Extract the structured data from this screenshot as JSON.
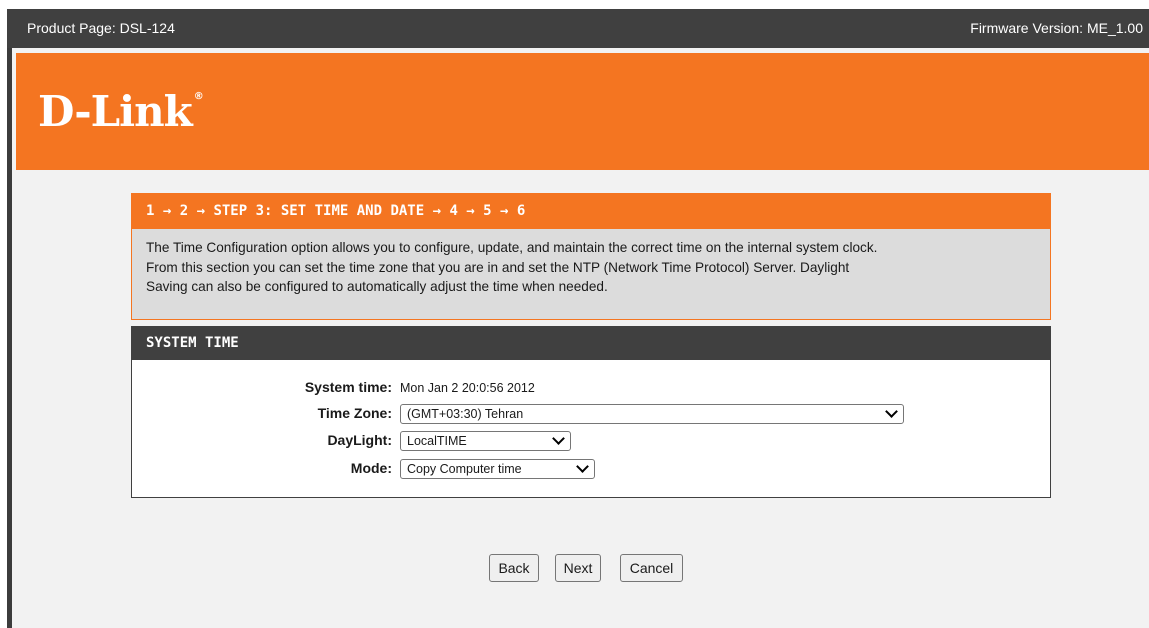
{
  "topbar": {
    "product": "Product Page: DSL-124",
    "firmware": "Firmware Version: ME_1.00"
  },
  "logo": {
    "text": "D-Link",
    "mark": "®"
  },
  "wizard": {
    "steps_prefix": "1 → 2 → ",
    "current_step": "STEP 3: SET TIME AND DATE",
    "steps_suffix": " → 4 → 5 → 6",
    "description_lines": [
      "The Time Configuration option allows you to configure, update, and maintain the correct time on the internal system clock.",
      "From this section you can set the time zone that you are in and set the NTP (Network Time Protocol) Server. Daylight",
      "Saving can also be configured to automatically adjust the time when needed."
    ]
  },
  "system_time": {
    "title": "SYSTEM TIME",
    "system_time_label": "System time:",
    "system_time_value": "Mon Jan 2 20:0:56 2012",
    "time_zone_label": "Time Zone:",
    "time_zone_value": "(GMT+03:30) Tehran",
    "daylight_label": "DayLight:",
    "daylight_value": "LocalTIME",
    "mode_label": "Mode:",
    "mode_value": "Copy Computer time"
  },
  "buttons": {
    "back": "Back",
    "next": "Next",
    "cancel": "Cancel"
  },
  "colors": {
    "accent": "#f47521",
    "dark": "#404040",
    "background": "#f2f2f2"
  }
}
